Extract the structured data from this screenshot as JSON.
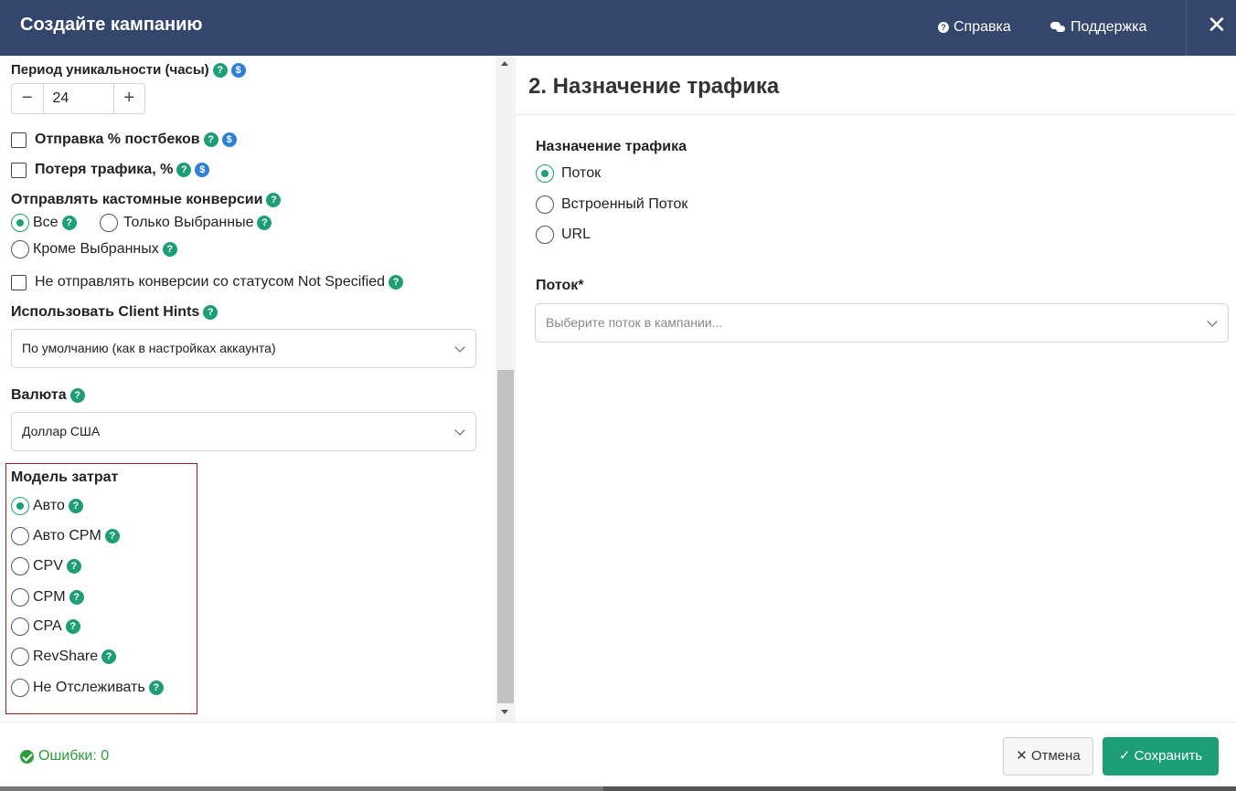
{
  "header": {
    "title": "Создайте кампанию",
    "help_label": "Справка",
    "support_label": "Поддержка",
    "close_label": "✕"
  },
  "left": {
    "uniqueness": {
      "label": "Период уникальности (часы)",
      "value": "24",
      "minus": "−",
      "plus": "+"
    },
    "postback_send": {
      "label": "Отправка % постбеков",
      "checked": false
    },
    "traffic_loss": {
      "label": "Потеря трафика, %",
      "checked": false
    },
    "custom_conversions": {
      "label": "Отправлять кастомные конверсии",
      "options": [
        "Все",
        "Только Выбранные",
        "Кроме Выбранных"
      ],
      "selected": "Все"
    },
    "not_specified": {
      "label": "Не отправлять конверсии со статусом Not Specified",
      "checked": false
    },
    "client_hints": {
      "label": "Использовать Client Hints",
      "value": "По умолчанию (как в настройках аккаунта)"
    },
    "currency": {
      "label": "Валюта",
      "value": "Доллар США"
    },
    "cost_model": {
      "label": "Модель затрат",
      "options": [
        "Авто",
        "Авто CPM",
        "CPV",
        "CPM",
        "CPA",
        "RevShare",
        "Не Отслеживать"
      ],
      "selected": "Авто"
    }
  },
  "right": {
    "section_title": "2. Назначение трафика",
    "destination": {
      "label": "Назначение трафика",
      "options": [
        "Поток",
        "Встроенный Поток",
        "URL"
      ],
      "selected": "Поток"
    },
    "flow": {
      "label": "Поток*",
      "placeholder": "Выберите поток в кампании..."
    }
  },
  "footer": {
    "errors_label": "Ошибки: 0",
    "cancel_label": "✕ Отмена",
    "save_label": "✓ Сохранить"
  },
  "colors": {
    "header_bg": "#34466b",
    "accent": "#1e9e77",
    "highlight_border": "#9a1d1d",
    "ok": "#2e9c3c"
  }
}
